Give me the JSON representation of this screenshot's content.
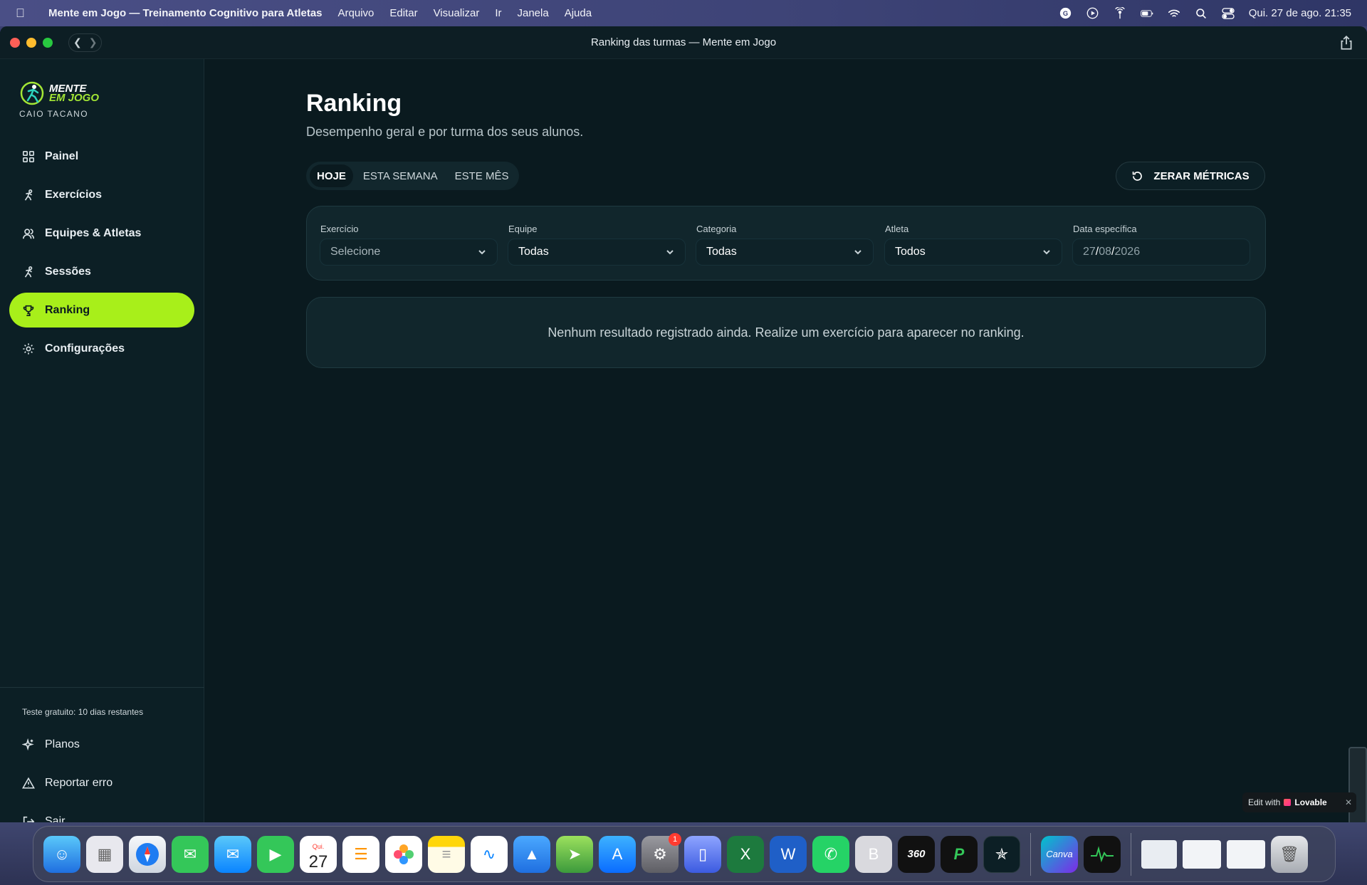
{
  "menubar": {
    "app_name": "Mente em Jogo — Treinamento Cognitivo para Atletas",
    "menus": [
      "Arquivo",
      "Editar",
      "Visualizar",
      "Ir",
      "Janela",
      "Ajuda"
    ],
    "clock": "Qui. 27 de ago.  21:35"
  },
  "window": {
    "title": "Ranking das turmas — Mente em Jogo"
  },
  "sidebar": {
    "brand_line1": "MENTE",
    "brand_line2": "EM JOGO",
    "user_name": "CAIO TACANO",
    "items": [
      {
        "label": "Painel",
        "icon": "dashboard-icon"
      },
      {
        "label": "Exercícios",
        "icon": "exercises-icon"
      },
      {
        "label": "Equipes & Atletas",
        "icon": "users-icon"
      },
      {
        "label": "Sessões",
        "icon": "sessions-icon"
      },
      {
        "label": "Ranking",
        "icon": "trophy-icon",
        "active": true
      },
      {
        "label": "Configurações",
        "icon": "gear-icon"
      }
    ],
    "trial_text": "Teste gratuito: 10 dias restantes",
    "bottom_items": [
      {
        "label": "Planos",
        "icon": "sparkles-icon"
      },
      {
        "label": "Reportar erro",
        "icon": "warning-icon"
      },
      {
        "label": "Sair",
        "icon": "logout-icon"
      }
    ]
  },
  "main": {
    "title": "Ranking",
    "subtitle": "Desempenho geral e por turma dos seus alunos.",
    "tabs": [
      {
        "label": "HOJE",
        "active": true
      },
      {
        "label": "ESTA SEMANA"
      },
      {
        "label": "ESTE MÊS"
      }
    ],
    "reset_label": "ZERAR MÉTRICAS",
    "filters": {
      "exercicio": {
        "label": "Exercício",
        "value": "Selecione"
      },
      "equipe": {
        "label": "Equipe",
        "value": "Todas"
      },
      "categoria": {
        "label": "Categoria",
        "value": "Todas"
      },
      "atleta": {
        "label": "Atleta",
        "value": "Todos"
      },
      "data": {
        "label": "Data específica",
        "day": "27",
        "month": "08",
        "year": "2026"
      }
    },
    "empty_message": "Nenhum resultado registrado ainda. Realize um exercício para aparecer no ranking."
  },
  "lovable": {
    "prefix": "Edit with",
    "brand": "Lovable"
  },
  "dock": {
    "calendar_month": "Qui.",
    "calendar_day": "27",
    "settings_badge": "1",
    "canva_label": "Canva",
    "app_360_label": "360"
  },
  "colors": {
    "accent": "#a8ef1a",
    "background": "#0a1a1f",
    "panel": "#11262c"
  }
}
